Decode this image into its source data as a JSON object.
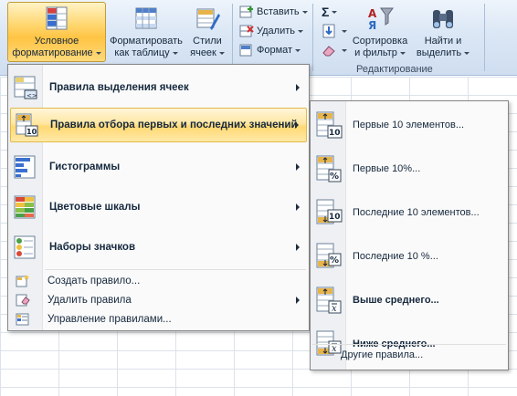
{
  "ribbon": {
    "cond_format": {
      "line1": "Условное",
      "line2": "форматирование"
    },
    "format_table": {
      "line1": "Форматировать",
      "line2": "как таблицу"
    },
    "cell_styles": {
      "line1": "Стили",
      "line2": "ячеек"
    },
    "insert": "Вставить",
    "delete": "Удалить",
    "format": "Формат",
    "sigma": "Σ",
    "sort_filter": {
      "line1": "Сортировка",
      "line2": "и фильтр"
    },
    "find_select": {
      "line1": "Найти и",
      "line2": "выделить"
    },
    "editing_group": "Редактирование"
  },
  "menu": {
    "items": [
      {
        "label": "Правила выделения ячеек",
        "icon": "highlight-rules-icon"
      },
      {
        "label": "Правила отбора первых и последних значений",
        "icon": "top-bottom-rules-icon"
      },
      {
        "label": "Гистограммы",
        "icon": "data-bars-icon"
      },
      {
        "label": "Цветовые шкалы",
        "icon": "color-scales-icon"
      },
      {
        "label": "Наборы значков",
        "icon": "icon-sets-icon"
      }
    ],
    "small_items": [
      {
        "label": "Создать правило...",
        "icon": "new-rule-icon"
      },
      {
        "label": "Удалить правила",
        "icon": "clear-rules-icon"
      },
      {
        "label": "Управление правилами...",
        "icon": "manage-rules-icon"
      }
    ]
  },
  "submenu": {
    "items": [
      {
        "label": "Первые 10 элементов...",
        "glyph": "10",
        "dir": "up"
      },
      {
        "label": "Первые 10%...",
        "glyph": "%",
        "dir": "up"
      },
      {
        "label": "Последние 10 элементов...",
        "glyph": "10",
        "dir": "down"
      },
      {
        "label": "Последние 10 %...",
        "glyph": "%",
        "dir": "down"
      },
      {
        "label": "Выше среднего...",
        "glyph": "x̄",
        "dir": "up"
      },
      {
        "label": "Ниже среднего...",
        "glyph": "x̄",
        "dir": "down"
      }
    ],
    "other": "Другие правила..."
  },
  "colors": {
    "highlight": "#ffd873",
    "menu_border": "#868686",
    "ribbon": "#dbe7f5"
  }
}
